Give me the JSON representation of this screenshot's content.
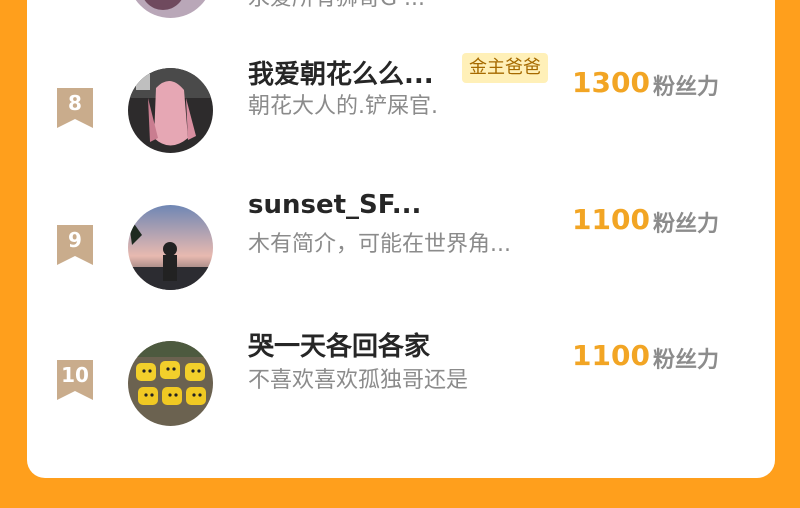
{
  "top_partial": {
    "bio": "永爱所有狮哥G‘..."
  },
  "rows": [
    {
      "rank": "8",
      "name": "我爱朝花么么...",
      "tag": "金主爸爸",
      "bio": "朝花大人的.铲屎官.",
      "score": "1300",
      "unit": "粉丝力"
    },
    {
      "rank": "9",
      "name": "sunset_SF...",
      "bio": "木有简介，可能在世界角...",
      "score": "1100",
      "unit": "粉丝力"
    },
    {
      "rank": "10",
      "name": "哭一天各回各家",
      "bio": "不喜欢喜欢孤独哥还是",
      "score": "1100",
      "unit": "粉丝力"
    }
  ],
  "colors": {
    "background": "#ff9f1c",
    "card": "#ffffff",
    "score": "#f2a524",
    "rank_badge": "#c9ac8c",
    "tag_bg": "#fff0b8"
  }
}
